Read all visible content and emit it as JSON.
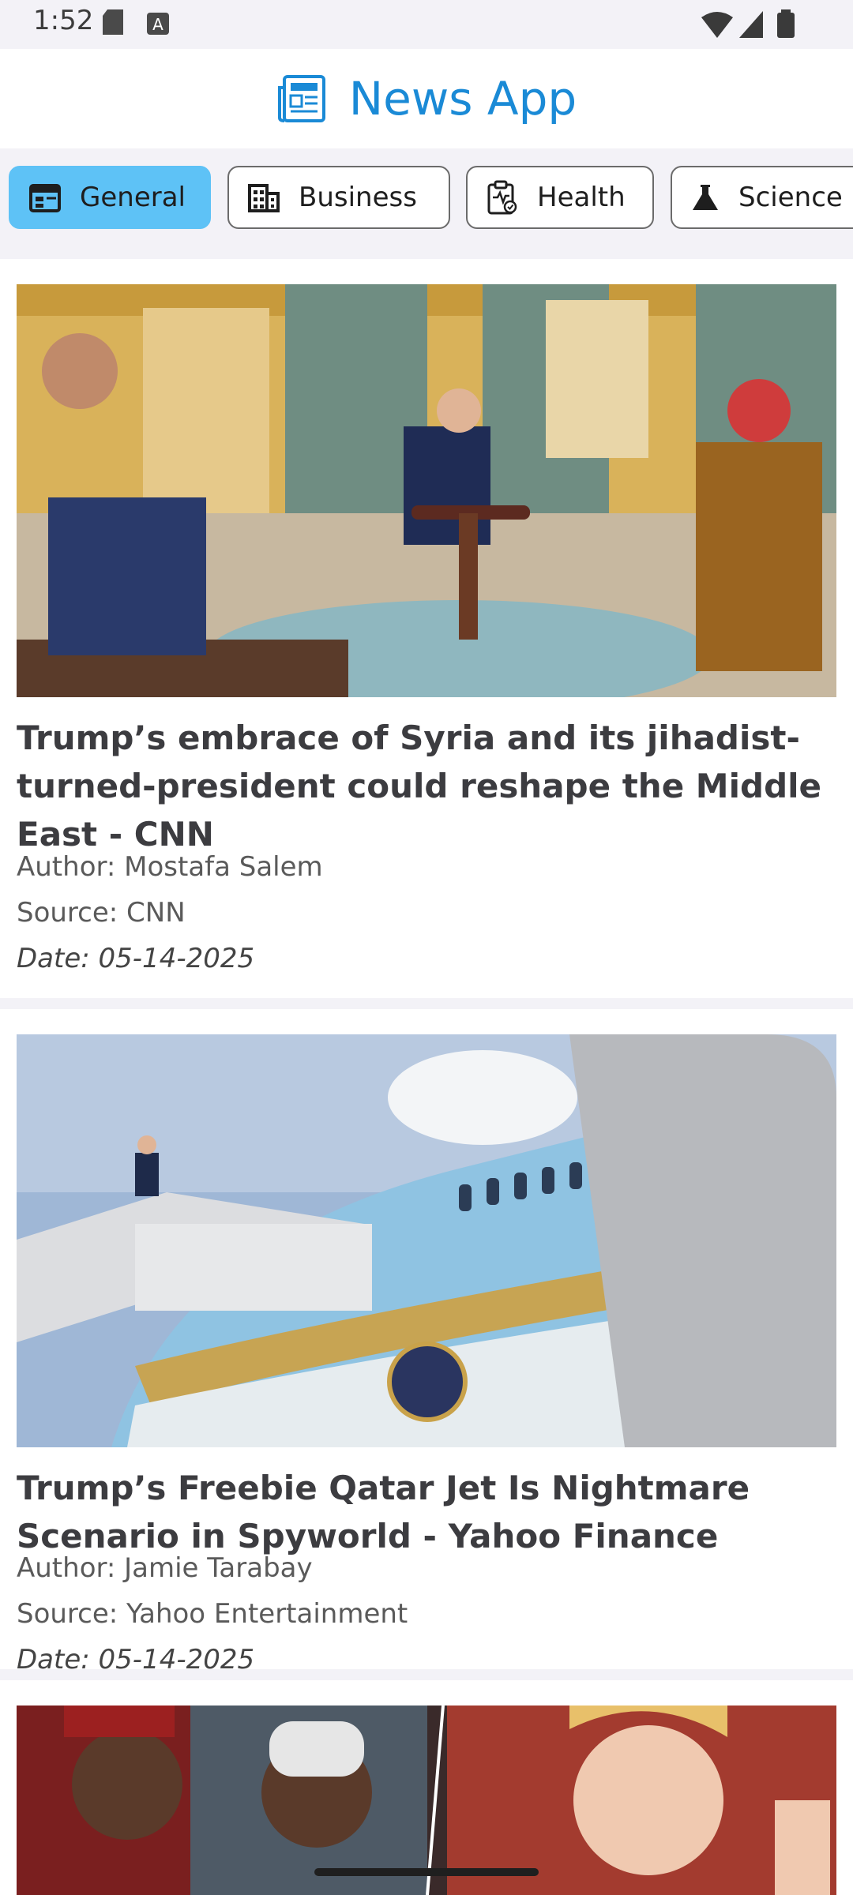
{
  "status": {
    "time": "1:52"
  },
  "app": {
    "title": "News App",
    "icon": "newspaper-icon",
    "accent": "#1a8ad6"
  },
  "tabs": [
    {
      "label": "General",
      "icon": "calendar-icon",
      "active": true
    },
    {
      "label": "Business",
      "icon": "building-icon",
      "active": false
    },
    {
      "label": "Health",
      "icon": "clipboard-health-icon",
      "active": false
    },
    {
      "label": "Science",
      "icon": "flask-icon",
      "active": false
    }
  ],
  "articles": [
    {
      "title": "Trump’s embrace of Syria and its jihadist-turned-president could reshape the Middle East - CNN",
      "author": "Author: Mostafa Salem",
      "source": "Source: CNN",
      "date": "Date: 05-14-2025"
    },
    {
      "title": "Trump’s Freebie Qatar Jet Is Nightmare Scenario in Spyworld - Yahoo Finance",
      "author": "Author: Jamie Tarabay",
      "source": "Source: Yahoo Entertainment",
      "date": "Date: 05-14-2025"
    },
    {
      "title": "",
      "author": "",
      "source": "",
      "date": ""
    }
  ]
}
